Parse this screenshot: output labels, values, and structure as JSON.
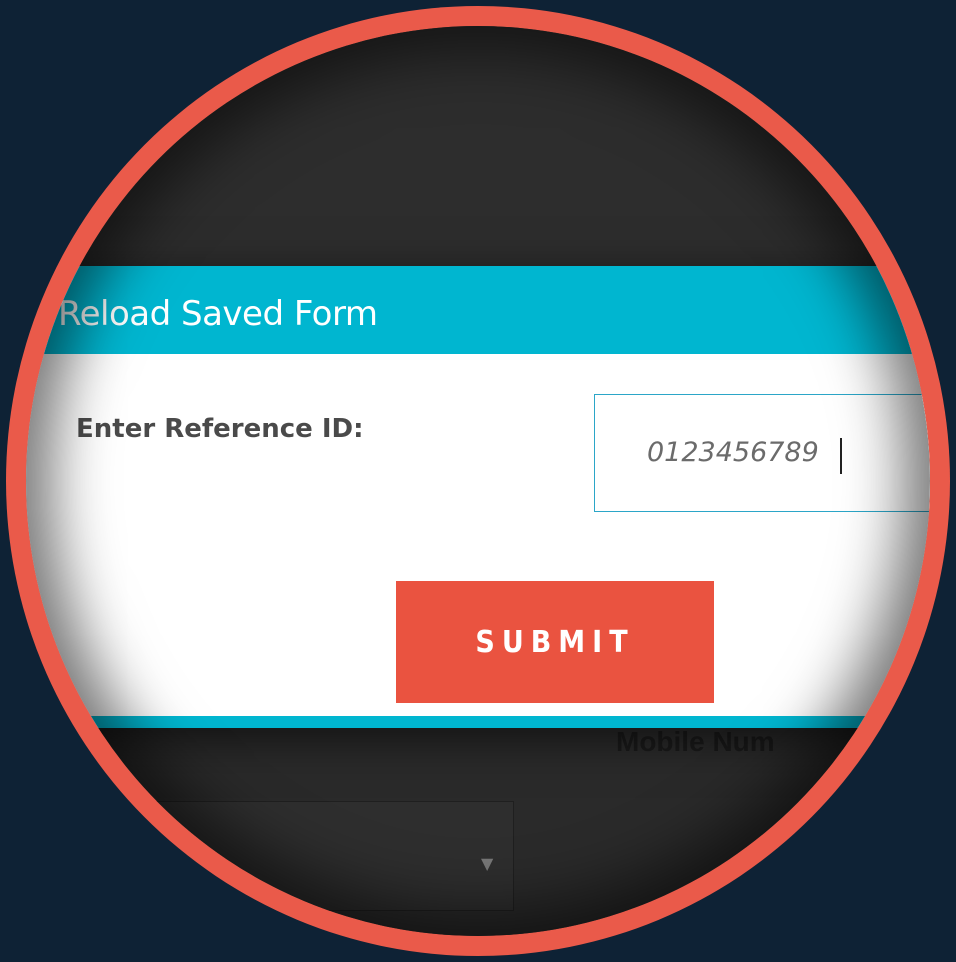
{
  "modal": {
    "title": "Reload Saved Form",
    "label": "Enter Reference ID:",
    "reference_value": "0123456789",
    "submit_label": "SUBMIT"
  },
  "background": {
    "partial_label": "Mobile Num",
    "select_arrow": "▼"
  },
  "colors": {
    "ring": "#ea5a4a",
    "header": "#00b6d0",
    "submit": "#ea5340",
    "page_background": "#0e2235"
  }
}
